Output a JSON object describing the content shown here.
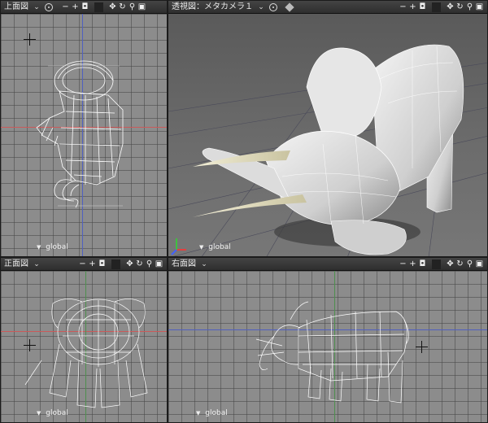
{
  "viewports": {
    "top": {
      "title": "上面図",
      "mode": "global"
    },
    "perspective": {
      "title": "透視図：メタカメラ１",
      "mode": "global"
    },
    "front": {
      "title": "正面図",
      "mode": "global"
    },
    "right": {
      "title": "右面図",
      "mode": "global"
    }
  },
  "header_tools": {
    "dropdown": "⌄",
    "zoom_out": "−",
    "zoom_in": "+",
    "camera": "◘",
    "move": "✥",
    "rotate": "↻",
    "search": "⚲",
    "frame": "▣"
  },
  "colors": {
    "axis_x": "#c95a5a",
    "axis_y": "#4f8f4f",
    "axis_z": "#5060c0",
    "background": "#8c8c8c"
  }
}
